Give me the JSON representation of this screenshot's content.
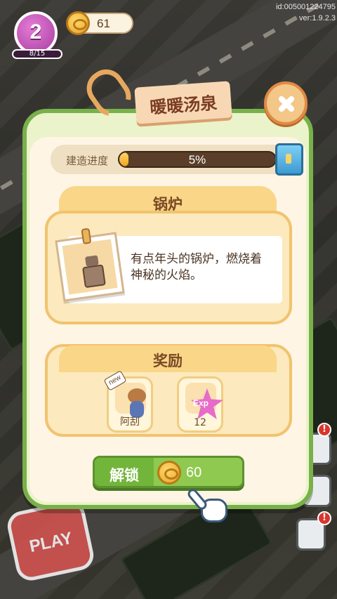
{
  "hud": {
    "level": "2",
    "xp_progress": "8/15",
    "coins": "61"
  },
  "meta": {
    "id": "id:005001224795",
    "version": "ver:1.9.2.3"
  },
  "dialog": {
    "title": "暖暖汤泉",
    "progress_label": "建造进度",
    "progress_text": "5%",
    "progress_fraction": 0.05,
    "section_item_title": "锅炉",
    "item_description": "有点年头的锅炉，燃烧着神秘的火焰。",
    "section_reward_title": "奖励",
    "rewards": [
      {
        "label": "阿刮",
        "new_tag": "new",
        "icon": "cat-character-icon"
      },
      {
        "label": "12",
        "badge_text": "Exp",
        "icon": "exp-star-icon"
      }
    ],
    "unlock_label": "解锁",
    "unlock_price": "60"
  },
  "play_button_label": "PLAY",
  "alert_symbol": "!",
  "colors": {
    "panel_green": "#78b04a",
    "button_green": "#8fc950",
    "level_purple": "#a83ea0",
    "alert_red": "#d8362e"
  }
}
